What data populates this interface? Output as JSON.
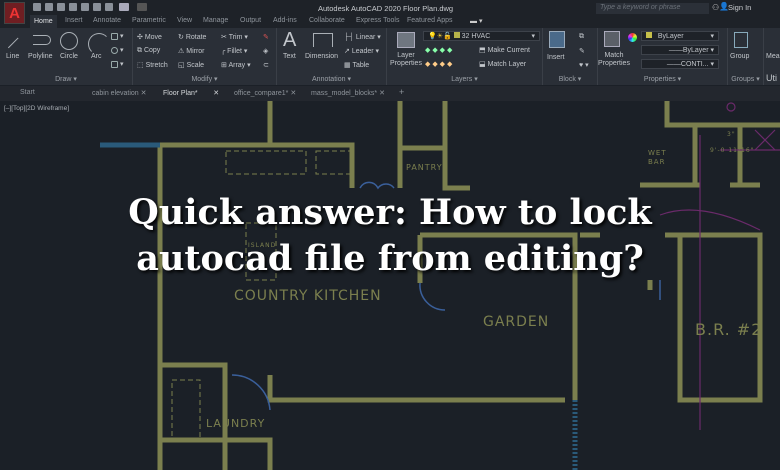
{
  "app": {
    "title": "Autodesk AutoCAD 2020   Floor Plan.dwg",
    "logo": "A",
    "search_placeholder": "Type a keyword or phrase",
    "sign_in": "Sign In"
  },
  "ribbon_tabs": [
    "Home",
    "Insert",
    "Annotate",
    "Parametric",
    "View",
    "Manage",
    "Output",
    "Add-ins",
    "Collaborate",
    "Express Tools",
    "Featured Apps"
  ],
  "panels": {
    "draw": {
      "label": "Draw",
      "tools": [
        "Line",
        "Polyline",
        "Circle",
        "Arc"
      ]
    },
    "modify": {
      "label": "Modify",
      "tools": [
        "Move",
        "Rotate",
        "Trim",
        "Copy",
        "Mirror",
        "Fillet",
        "Stretch",
        "Scale",
        "Array"
      ]
    },
    "annotation": {
      "label": "Annotation",
      "tools": [
        "Text",
        "Dimension",
        "Linear",
        "Leader",
        "Table"
      ]
    },
    "layers": {
      "label": "Layers",
      "layer_properties": "Layer Properties",
      "current_layer": "32 HVAC",
      "make_current": "Make Current",
      "match_layer": "Match Layer"
    },
    "block": {
      "label": "Block",
      "insert": "Insert"
    },
    "properties": {
      "label": "Properties",
      "match": "Match Properties",
      "color": "ByLayer",
      "lineweight": "ByLayer",
      "linetype": "CONTI..."
    },
    "groups": {
      "label": "Groups",
      "group": "Group"
    },
    "utilities": {
      "label": "Uti",
      "measure": "Mea"
    }
  },
  "doc_tabs": [
    "Start",
    "cabin elevation",
    "Floor Plan*",
    "office_compare1*",
    "mass_model_blocks*"
  ],
  "active_doc_tab": "Floor Plan*",
  "viewport_label": "[–][Top][2D Wireframe]",
  "rooms": [
    "PANTRY",
    "ISLAND",
    "COUNTRY KITCHEN",
    "GARDEN",
    "LAUNDRY",
    "WET",
    "BAR",
    "B.R. #2",
    "9'-0 11/16\"",
    "3\""
  ],
  "headline": [
    "Quick answer: How to lock",
    "autocad file from editing?"
  ],
  "colors": {
    "wall": "#7b7f4e",
    "door": "#3a5f9a",
    "hvac": "#6a2a6a",
    "canvas": "#1b2027"
  }
}
